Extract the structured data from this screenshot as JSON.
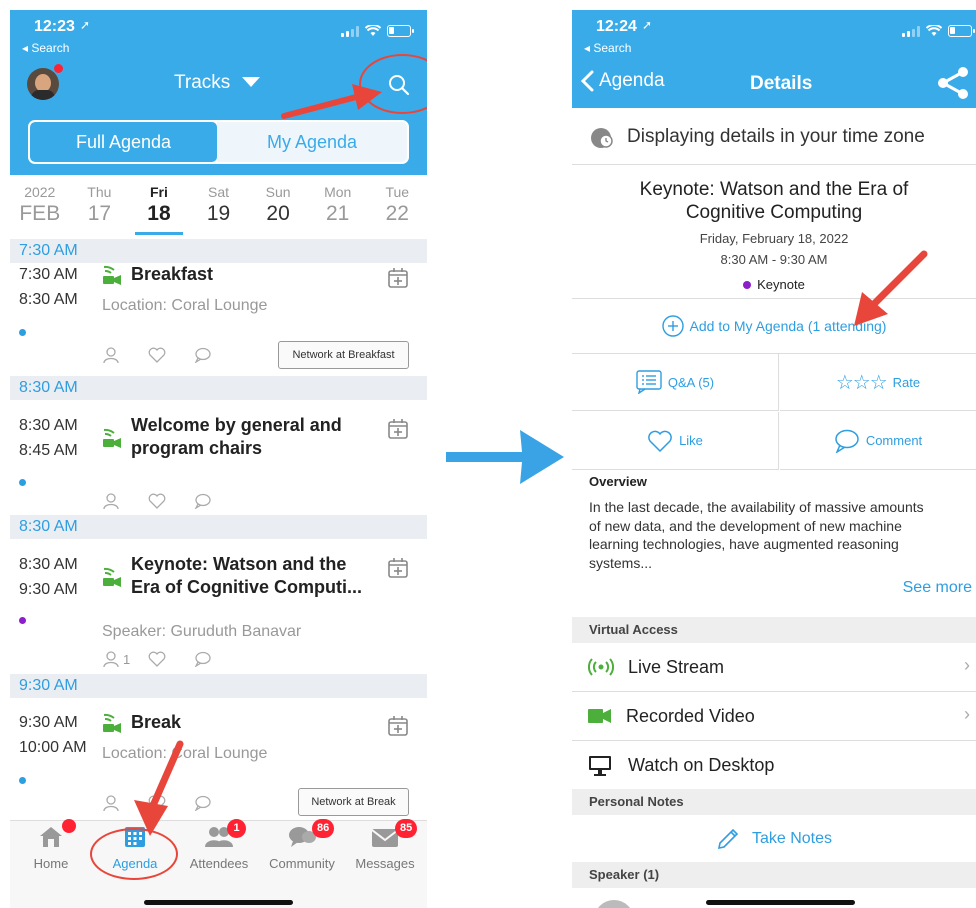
{
  "left": {
    "status": {
      "time": "12:23",
      "back": "◂ Search"
    },
    "header": {
      "title": "Tracks"
    },
    "segments": [
      "Full Agenda",
      "My Agenda"
    ],
    "days": [
      {
        "name": "2022",
        "num": "FEB"
      },
      {
        "name": "Thu",
        "num": "17"
      },
      {
        "name": "Fri",
        "num": "18"
      },
      {
        "name": "Sat",
        "num": "19"
      },
      {
        "name": "Sun",
        "num": "20"
      },
      {
        "name": "Mon",
        "num": "21"
      },
      {
        "name": "Tue",
        "num": "22"
      }
    ],
    "sections": [
      "7:30 AM",
      "8:30 AM",
      "8:30 AM",
      "9:30 AM"
    ],
    "events": [
      {
        "start": "7:30 AM",
        "end": "8:30 AM",
        "title": "Breakfast",
        "sub": "Location: Coral Lounge",
        "button": "Network at Breakfast",
        "dot": "#2e9ee0"
      },
      {
        "start": "8:30 AM",
        "end": "8:45 AM",
        "title1": "Welcome by general and",
        "title2": "program chairs",
        "dot": "#2e9ee0"
      },
      {
        "start": "8:30 AM",
        "end": "9:30 AM",
        "title1": "Keynote: Watson and the",
        "title2": "Era of Cognitive Computi...",
        "sub": "Speaker: Guruduth Banavar",
        "count": "1",
        "dot": "#8b1fc9"
      },
      {
        "start": "9:30 AM",
        "end": "10:00 AM",
        "title": "Break",
        "sub": "Location: Coral Lounge",
        "button": "Network at Break",
        "dot": "#2e9ee0"
      }
    ],
    "nav": [
      {
        "label": "Home"
      },
      {
        "label": "Agenda"
      },
      {
        "label": "Attendees",
        "badge": "1"
      },
      {
        "label": "Community",
        "badge": "86"
      },
      {
        "label": "Messages",
        "badge": "85"
      }
    ]
  },
  "right": {
    "status": {
      "time": "12:24",
      "back": "◂ Search"
    },
    "header": {
      "back": "Agenda",
      "title": "Details"
    },
    "timezone": "Displaying details in your time zone",
    "session": {
      "title1": "Keynote: Watson and the Era of",
      "title2": "Cognitive Computing",
      "date": "Friday, February 18, 2022",
      "time": "8:30 AM - 9:30 AM",
      "track": "Keynote"
    },
    "add_agenda": "Add to My Agenda (1 attending)",
    "actions": {
      "qa": "Q&A (5)",
      "rate": "Rate",
      "like": "Like",
      "comment": "Comment"
    },
    "overview": {
      "heading": "Overview",
      "lines": [
        "In the last decade, the availability of massive amounts",
        "of new data, and the development of new machine",
        "learning technologies, have augmented reasoning",
        "systems..."
      ],
      "see_more": "See more"
    },
    "virtual": {
      "heading": "Virtual Access",
      "items": [
        "Live Stream",
        "Recorded Video",
        "Watch on Desktop"
      ]
    },
    "notes": {
      "heading": "Personal Notes",
      "take": "Take Notes"
    },
    "speaker_heading": "Speaker (1)"
  },
  "colors": {
    "brand": "#3aabe9",
    "annotation": "#e8463a",
    "green": "#4caf3b"
  }
}
